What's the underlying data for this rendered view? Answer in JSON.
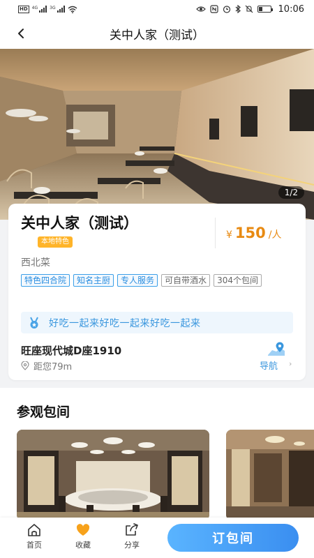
{
  "status_bar": {
    "time": "10:06",
    "left_icons": [
      "hd-icon",
      "signal-4g-icon",
      "signal-3g-icon",
      "wifi-icon"
    ],
    "right_icons": [
      "eye-icon",
      "nfc-icon",
      "alarm-icon",
      "bluetooth-icon",
      "mute-icon",
      "battery-icon"
    ]
  },
  "nav": {
    "title": "关中人家（测试）",
    "back_icon": "chevron-left-icon"
  },
  "hero": {
    "counter": "1/2"
  },
  "restaurant": {
    "name": "关中人家（测试）",
    "badge": "本地特色",
    "price_currency": "¥",
    "price_value": "150",
    "price_unit": "/人",
    "cuisine": "西北菜",
    "tags": [
      {
        "label": "特色四合院",
        "style": "blue"
      },
      {
        "label": "知名主厨",
        "style": "blue"
      },
      {
        "label": "专人服务",
        "style": "blue"
      },
      {
        "label": "可自带酒水",
        "style": "gray"
      },
      {
        "label": "304个包间",
        "style": "gray"
      }
    ],
    "slogan": "好吃一起来好吃一起来好吃一起来",
    "address": "旺座现代城D座1910",
    "distance": "距您79m",
    "nav_label": "导航"
  },
  "rooms_section": {
    "title": "参观包间"
  },
  "bottom_bar": {
    "tabs": [
      {
        "label": "首页",
        "icon": "home-icon"
      },
      {
        "label": "收藏",
        "icon": "heart-icon"
      },
      {
        "label": "分享",
        "icon": "share-icon"
      }
    ],
    "book_label": "订包间"
  },
  "colors": {
    "accent_blue": "#3a97de",
    "price_orange": "#e88a12",
    "badge_yellow": "#ffb429",
    "heart_orange": "#f7a21b"
  }
}
